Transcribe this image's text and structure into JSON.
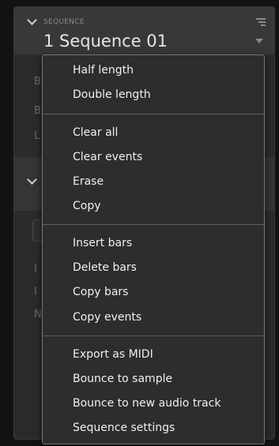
{
  "sequence_panel": {
    "section_label": "SEQUENCE",
    "title": "1 Sequence 01"
  },
  "context_menu": {
    "groups": [
      {
        "items": [
          {
            "label": "Half length"
          },
          {
            "label": "Double length"
          }
        ]
      },
      {
        "items": [
          {
            "label": "Clear all"
          },
          {
            "label": "Clear events"
          },
          {
            "label": "Erase"
          },
          {
            "label": "Copy"
          }
        ]
      },
      {
        "items": [
          {
            "label": "Insert bars"
          },
          {
            "label": "Delete bars"
          },
          {
            "label": "Copy bars"
          },
          {
            "label": "Copy events"
          }
        ]
      },
      {
        "items": [
          {
            "label": "Export as MIDI"
          },
          {
            "label": "Bounce to sample"
          },
          {
            "label": "Bounce to new audio track"
          },
          {
            "label": "Sequence settings"
          }
        ]
      }
    ]
  },
  "background_fragments": {
    "row1": "B",
    "row2": "B",
    "row3": "L",
    "row4": "I",
    "row5": "I",
    "row6": "N"
  },
  "colors": {
    "background": "#121212",
    "panel": "#2b2b2b",
    "menu": "#2d2d2d",
    "menu_border": "#777777",
    "text": "#f0f0f0"
  },
  "icons": {
    "collapse": "chevron-down-icon",
    "options": "menu-lines-icon",
    "dropdown": "triangle-down-icon"
  }
}
